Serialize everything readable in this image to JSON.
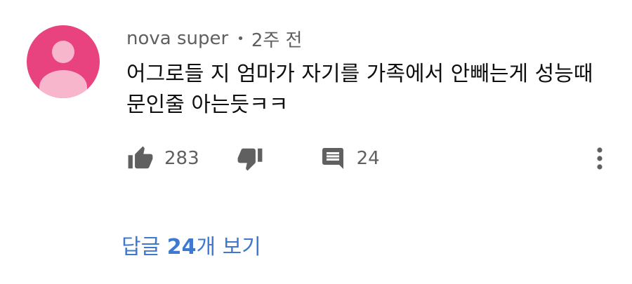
{
  "comment": {
    "author": "nova super",
    "separator": "•",
    "time_ago": "2주 전",
    "text": "어그로들 지 엄마가 자기를 가족에서 안빼는게 성능때문인줄 아는듯ㅋㅋ",
    "avatar_color": "#e8437e"
  },
  "actions": {
    "like_icon": "thumbs-up-icon",
    "like_count": "283",
    "dislike_icon": "thumbs-down-icon",
    "reply_icon": "comment-icon",
    "reply_count": "24",
    "more_icon": "more-vert-icon"
  },
  "replies": {
    "prefix": "답글 ",
    "count": "24",
    "suffix": "개 보기",
    "color": "#3e79cf"
  }
}
